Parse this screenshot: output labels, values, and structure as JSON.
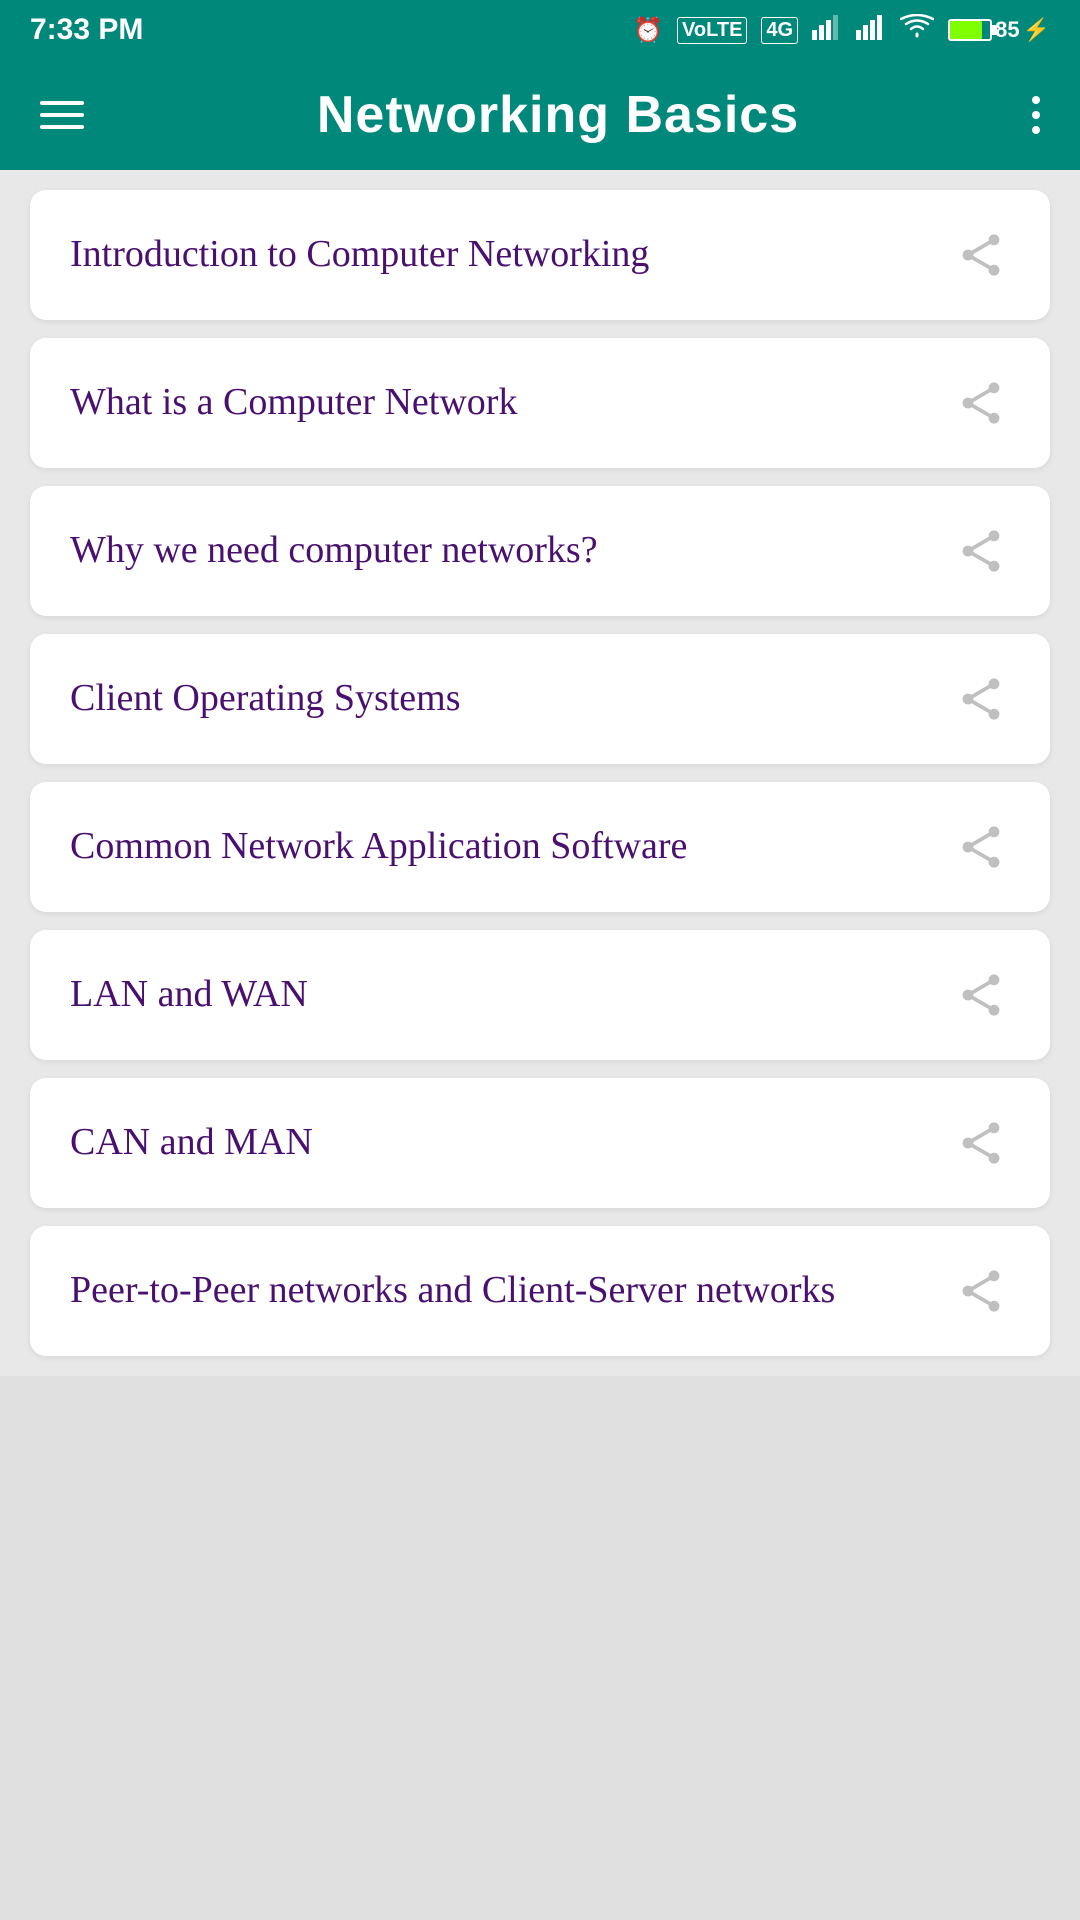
{
  "statusBar": {
    "time": "7:33 PM",
    "battery": "85"
  },
  "header": {
    "title": "Networking Basics",
    "menuIcon": "hamburger-icon",
    "moreIcon": "more-options-icon"
  },
  "listItems": [
    {
      "id": 1,
      "label": "Introduction to Computer Networking"
    },
    {
      "id": 2,
      "label": "What is a Computer Network"
    },
    {
      "id": 3,
      "label": "Why we need computer networks?"
    },
    {
      "id": 4,
      "label": "Client Operating Systems"
    },
    {
      "id": 5,
      "label": "Common Network Application Software"
    },
    {
      "id": 6,
      "label": "LAN and WAN"
    },
    {
      "id": 7,
      "label": "CAN and MAN"
    },
    {
      "id": 8,
      "label": "Peer-to-Peer networks and Client-Server networks"
    }
  ]
}
